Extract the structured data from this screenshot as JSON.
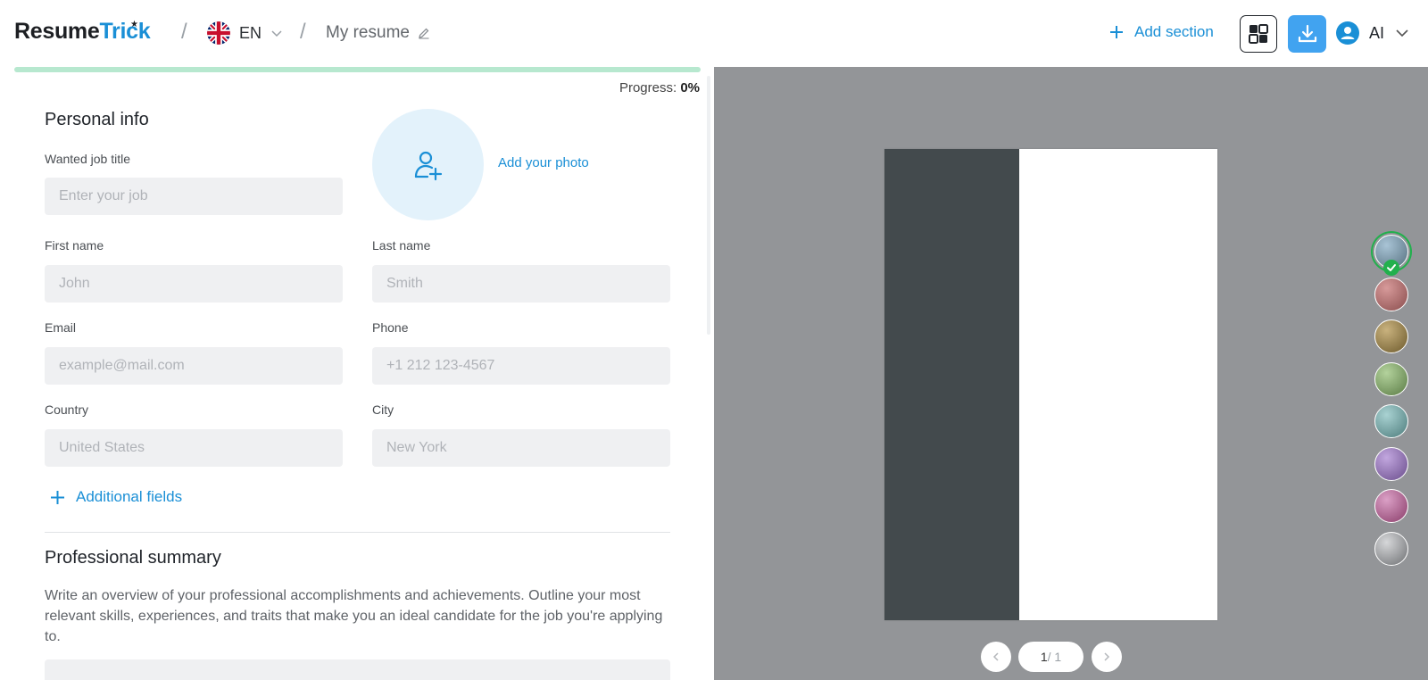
{
  "header": {
    "logo_main": "Resume",
    "logo_accent": "Trick",
    "language": "EN",
    "resume_name": "My resume",
    "add_section_label": "Add section",
    "user_name": "AI"
  },
  "progress": {
    "label": "Progress:",
    "value_text": "0%",
    "percent": 0
  },
  "personal_info": {
    "title": "Personal info",
    "wanted_job_title_label": "Wanted job title",
    "wanted_job_title_placeholder": "Enter your job",
    "add_photo_label": "Add your photo",
    "first_name_label": "First name",
    "first_name_placeholder": "John",
    "last_name_label": "Last name",
    "last_name_placeholder": "Smith",
    "email_label": "Email",
    "email_placeholder": "example@mail.com",
    "phone_label": "Phone",
    "phone_placeholder": "+1 212 123-4567",
    "country_label": "Country",
    "country_placeholder": "United States",
    "city_label": "City",
    "city_placeholder": "New York",
    "additional_fields_label": "Additional fields"
  },
  "summary": {
    "title": "Professional summary",
    "description": "Write an overview of your professional accomplishments and achievements. Outline your most relevant skills, experiences, and traits that make you an ideal candidate for the job you're applying to."
  },
  "preview": {
    "current_page": "1",
    "total_pages": "/ 1",
    "sidebar_color": "#434a4d",
    "background_color": "#939598"
  },
  "color_swatches": [
    {
      "name": "blue-gray",
      "from": "#a9c4d6",
      "to": "#56707f",
      "selected": true
    },
    {
      "name": "rose",
      "from": "#d79a9a",
      "to": "#8a4d4d"
    },
    {
      "name": "olive-gold",
      "from": "#c9b27e",
      "to": "#6d5a2c"
    },
    {
      "name": "sage-green",
      "from": "#b3d29c",
      "to": "#5a7b45"
    },
    {
      "name": "teal",
      "from": "#a9d2d2",
      "to": "#4d7c7c"
    },
    {
      "name": "lavender",
      "from": "#c2a7df",
      "to": "#6a4d8c"
    },
    {
      "name": "magenta",
      "from": "#dba0c6",
      "to": "#8a3d6a"
    },
    {
      "name": "silver",
      "from": "#d6d7d9",
      "to": "#6e7073"
    }
  ],
  "colors": {
    "accent": "#1a8fd6",
    "download_button": "#41a3f0",
    "success": "#22b04d",
    "progress_track": "#b7e8cf"
  }
}
